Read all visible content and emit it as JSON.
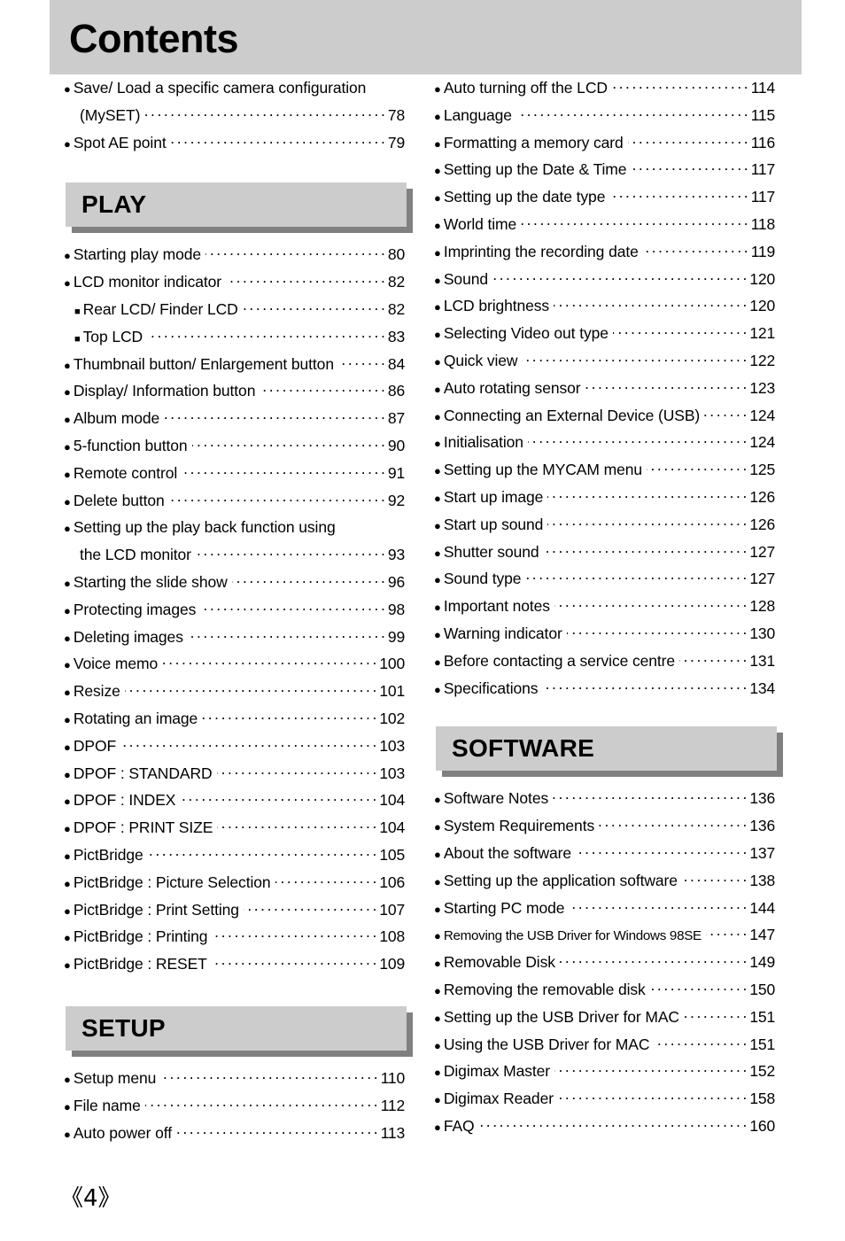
{
  "page": {
    "title": "Contents",
    "page_number": "《4》"
  },
  "left_column": {
    "top_entries": [
      {
        "bullet": "disc",
        "label": "Save/ Load a specific camera configuration",
        "page": "",
        "leader": false
      },
      {
        "bullet": "none",
        "label": "(MySET)",
        "page": "78",
        "leader": true,
        "continuation": true
      },
      {
        "bullet": "disc",
        "label": "Spot AE point",
        "page": "79",
        "leader": true
      }
    ],
    "sections": [
      {
        "name": "PLAY",
        "entries": [
          {
            "bullet": "disc",
            "label": "Starting play mode",
            "page": "80",
            "leader": true
          },
          {
            "bullet": "disc",
            "label": "LCD monitor indicator",
            "page": "82",
            "leader": true
          },
          {
            "bullet": "square",
            "label": "Rear LCD/ Finder LCD",
            "page": "82",
            "leader": true
          },
          {
            "bullet": "square",
            "label": "Top LCD",
            "page": "83",
            "leader": true
          },
          {
            "bullet": "disc",
            "label": "Thumbnail button/ Enlargement button",
            "page": "84",
            "leader": true
          },
          {
            "bullet": "disc",
            "label": "Display/ Information button",
            "page": "86",
            "leader": true
          },
          {
            "bullet": "disc",
            "label": "Album mode",
            "page": "87",
            "leader": true
          },
          {
            "bullet": "disc",
            "label": "5-function button",
            "page": "90",
            "leader": true
          },
          {
            "bullet": "disc",
            "label": "Remote control",
            "page": "91",
            "leader": true
          },
          {
            "bullet": "disc",
            "label": "Delete button",
            "page": "92",
            "leader": true
          },
          {
            "bullet": "disc",
            "label": "Setting up the play back function using",
            "page": "",
            "leader": false
          },
          {
            "bullet": "none",
            "label": "the LCD monitor",
            "page": "93",
            "leader": true,
            "continuation": true
          },
          {
            "bullet": "disc",
            "label": "Starting the slide show",
            "page": "96",
            "leader": true
          },
          {
            "bullet": "disc",
            "label": "Protecting images",
            "page": "98",
            "leader": true
          },
          {
            "bullet": "disc",
            "label": "Deleting images",
            "page": "99",
            "leader": true
          },
          {
            "bullet": "disc",
            "label": "Voice memo",
            "page": "100",
            "leader": true
          },
          {
            "bullet": "disc",
            "label": "Resize",
            "page": "101",
            "leader": true
          },
          {
            "bullet": "disc",
            "label": "Rotating an image",
            "page": "102",
            "leader": true
          },
          {
            "bullet": "disc",
            "label": "DPOF",
            "page": "103",
            "leader": true
          },
          {
            "bullet": "disc",
            "label": "DPOF : STANDARD",
            "page": "103",
            "leader": true
          },
          {
            "bullet": "disc",
            "label": "DPOF : INDEX",
            "page": "104",
            "leader": true
          },
          {
            "bullet": "disc",
            "label": "DPOF : PRINT SIZE",
            "page": "104",
            "leader": true
          },
          {
            "bullet": "disc",
            "label": "PictBridge",
            "page": "105",
            "leader": true
          },
          {
            "bullet": "disc",
            "label": "PictBridge : Picture Selection",
            "page": "106",
            "leader": true
          },
          {
            "bullet": "disc",
            "label": "PictBridge : Print Setting",
            "page": "107",
            "leader": true
          },
          {
            "bullet": "disc",
            "label": "PictBridge : Printing",
            "page": "108",
            "leader": true
          },
          {
            "bullet": "disc",
            "label": "PictBridge : RESET",
            "page": "109",
            "leader": true
          }
        ]
      },
      {
        "name": "SETUP",
        "entries": [
          {
            "bullet": "disc",
            "label": "Setup menu",
            "page": "110",
            "leader": true
          },
          {
            "bullet": "disc",
            "label": "File name",
            "page": "112",
            "leader": true
          },
          {
            "bullet": "disc",
            "label": "Auto power off",
            "page": "113",
            "leader": true
          }
        ]
      }
    ]
  },
  "right_column": {
    "top_entries": [
      {
        "bullet": "disc",
        "label": "Auto turning off the LCD",
        "page": "114",
        "leader": true
      },
      {
        "bullet": "disc",
        "label": "Language",
        "page": "115",
        "leader": true
      },
      {
        "bullet": "disc",
        "label": "Formatting a memory card",
        "page": "116",
        "leader": true
      },
      {
        "bullet": "disc",
        "label": "Setting up the Date & Time",
        "page": "117",
        "leader": true
      },
      {
        "bullet": "disc",
        "label": "Setting up the date type",
        "page": "117",
        "leader": true
      },
      {
        "bullet": "disc",
        "label": "World time",
        "page": "118",
        "leader": true
      },
      {
        "bullet": "disc",
        "label": "Imprinting the recording date",
        "page": "119",
        "leader": true
      },
      {
        "bullet": "disc",
        "label": "Sound",
        "page": "120",
        "leader": true
      },
      {
        "bullet": "disc",
        "label": "LCD brightness",
        "page": "120",
        "leader": true
      },
      {
        "bullet": "disc",
        "label": "Selecting Video out type",
        "page": "121",
        "leader": true
      },
      {
        "bullet": "disc",
        "label": "Quick view",
        "page": "122",
        "leader": true
      },
      {
        "bullet": "disc",
        "label": "Auto rotating sensor",
        "page": "123",
        "leader": true
      },
      {
        "bullet": "disc",
        "label": "Connecting an External Device (USB)",
        "page": "124",
        "leader": true
      },
      {
        "bullet": "disc",
        "label": "Initialisation",
        "page": "124",
        "leader": true
      },
      {
        "bullet": "disc",
        "label": "Setting up the MYCAM menu",
        "page": "125",
        "leader": true
      },
      {
        "bullet": "disc",
        "label": "Start up image",
        "page": "126",
        "leader": true
      },
      {
        "bullet": "disc",
        "label": "Start up sound",
        "page": "126",
        "leader": true
      },
      {
        "bullet": "disc",
        "label": "Shutter sound",
        "page": "127",
        "leader": true
      },
      {
        "bullet": "disc",
        "label": "Sound type",
        "page": "127",
        "leader": true
      },
      {
        "bullet": "disc",
        "label": "Important notes",
        "page": "128",
        "leader": true
      },
      {
        "bullet": "disc",
        "label": "Warning indicator",
        "page": "130",
        "leader": true
      },
      {
        "bullet": "disc",
        "label": "Before contacting a service centre",
        "page": "131",
        "leader": true
      },
      {
        "bullet": "disc",
        "label": "Specifications",
        "page": "134",
        "leader": true
      }
    ],
    "sections": [
      {
        "name": "SOFTWARE",
        "entries": [
          {
            "bullet": "disc",
            "label": "Software Notes",
            "page": "136",
            "leader": true
          },
          {
            "bullet": "disc",
            "label": "System Requirements",
            "page": "136",
            "leader": true
          },
          {
            "bullet": "disc",
            "label": "About the software",
            "page": "137",
            "leader": true
          },
          {
            "bullet": "disc",
            "label": "Setting up the application software",
            "page": "138",
            "leader": true
          },
          {
            "bullet": "disc",
            "label": "Starting PC mode",
            "page": "144",
            "leader": true
          },
          {
            "bullet": "disc",
            "label": "Removing the USB Driver for Windows 98SE",
            "page": "147",
            "leader": true,
            "condensed": true
          },
          {
            "bullet": "disc",
            "label": "Removable Disk",
            "page": "149",
            "leader": true
          },
          {
            "bullet": "disc",
            "label": "Removing the removable disk",
            "page": "150",
            "leader": true
          },
          {
            "bullet": "disc",
            "label": "Setting up the USB Driver for MAC",
            "page": "151",
            "leader": true
          },
          {
            "bullet": "disc",
            "label": "Using the USB Driver for MAC",
            "page": "151",
            "leader": true
          },
          {
            "bullet": "disc",
            "label": "Digimax Master",
            "page": "152",
            "leader": true
          },
          {
            "bullet": "disc",
            "label": "Digimax Reader",
            "page": "158",
            "leader": true
          },
          {
            "bullet": "disc",
            "label": "FAQ",
            "page": "160",
            "leader": true
          }
        ]
      }
    ]
  },
  "colors": {
    "banner_gray": "#cccccc",
    "shadow_gray": "#808080",
    "text": "#000000"
  }
}
